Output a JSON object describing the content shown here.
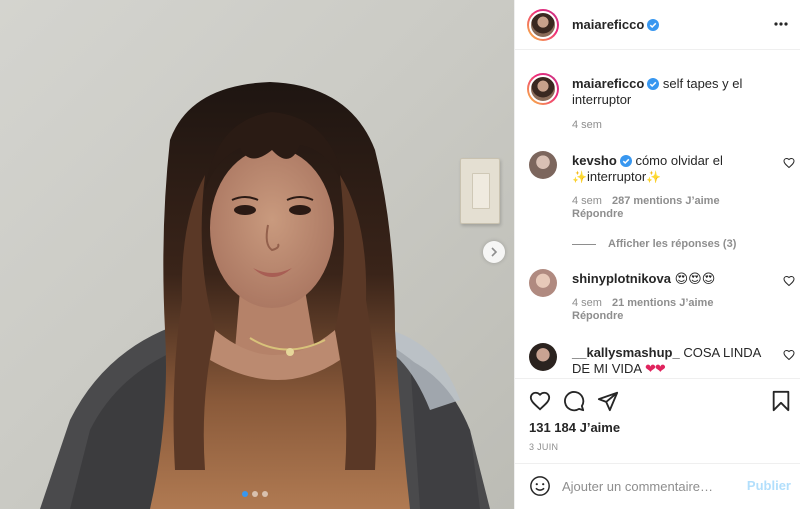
{
  "post": {
    "username": "maiareficco",
    "verified": true,
    "image_alt": "",
    "carousel": {
      "count": 3,
      "active_index": 0
    }
  },
  "caption": {
    "username": "maiareficco",
    "text": "self tapes y el interruptor",
    "time": "4 sem"
  },
  "comments": [
    {
      "username": "kevsho",
      "verified": true,
      "text_before": "cómo olvidar el ",
      "sparkle": "✨",
      "text_mid": "interruptor",
      "sparkle_end": "✨",
      "time": "4 sem",
      "likes": "287 mentions J’aime",
      "reply": "Répondre",
      "view_replies": "Afficher les réponses (3)"
    },
    {
      "username": "shinyplotnikova",
      "verified": false,
      "emoji": "😍😍😍",
      "time": "4 sem",
      "likes": "21 mentions J’aime",
      "reply": "Répondre"
    },
    {
      "username": "__kallysmashup_",
      "verified": false,
      "text": "COSA LINDA DE MI VIDA",
      "hearts": "❤❤"
    }
  ],
  "actions": {
    "icons": [
      "heart-icon",
      "comment-icon",
      "share-icon",
      "bookmark-icon"
    ],
    "likes_count": "131 184 J’aime",
    "date": "3 JUIN"
  },
  "add_comment": {
    "placeholder": "Ajouter un commentaire…",
    "post_label": "Publier"
  },
  "colors": {
    "verified": "#3897f0",
    "muted": "#8e8e8e",
    "text": "#262626",
    "publish_disabled": "#b2dffc",
    "carousel_active": "#3797f0"
  }
}
